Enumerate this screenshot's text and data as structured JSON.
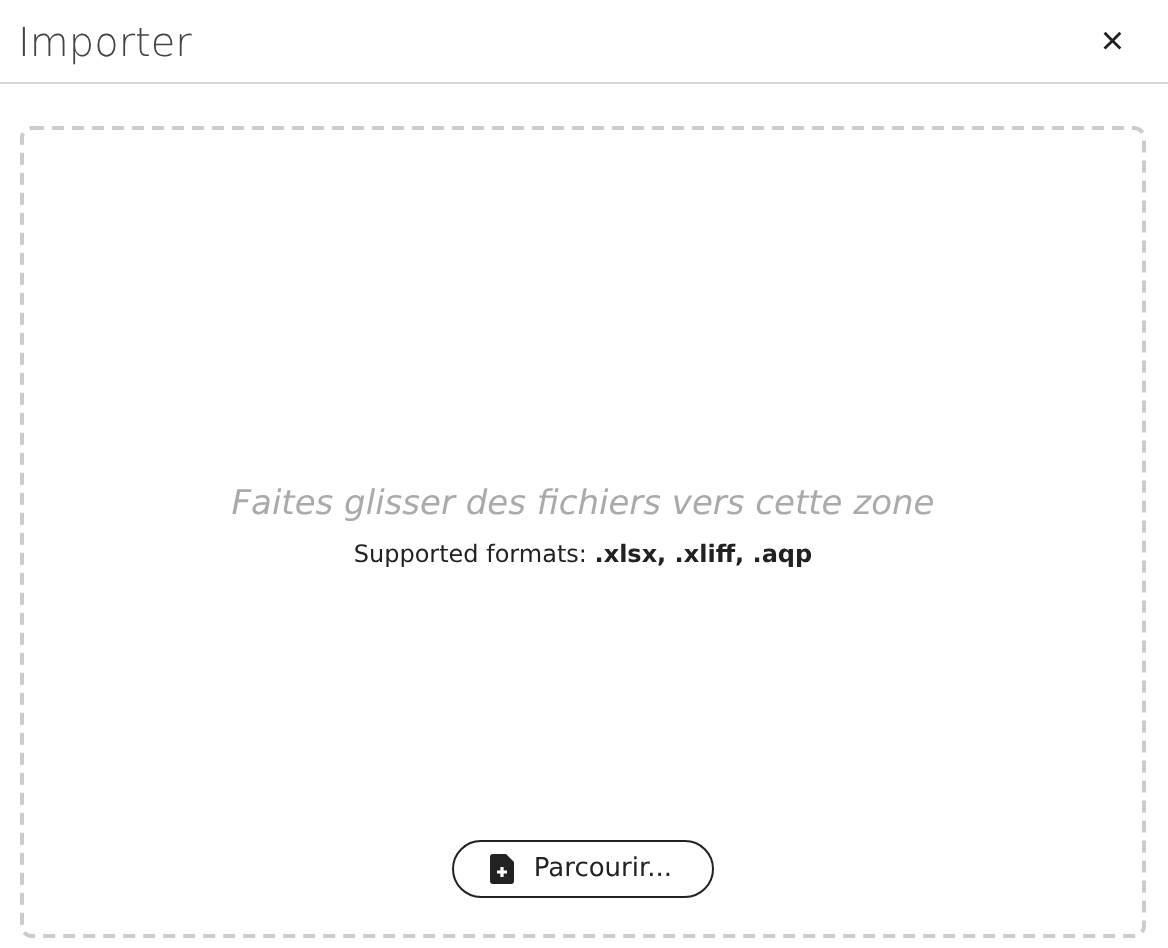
{
  "dialog": {
    "title": "Importer",
    "close": "×"
  },
  "dropzone": {
    "hint": "Faites glisser des fichiers vers cette zone",
    "formats": "Supported formats: **.xlsx, .xliff, .aqp**",
    "browse_button": "Parcourir..."
  }
}
